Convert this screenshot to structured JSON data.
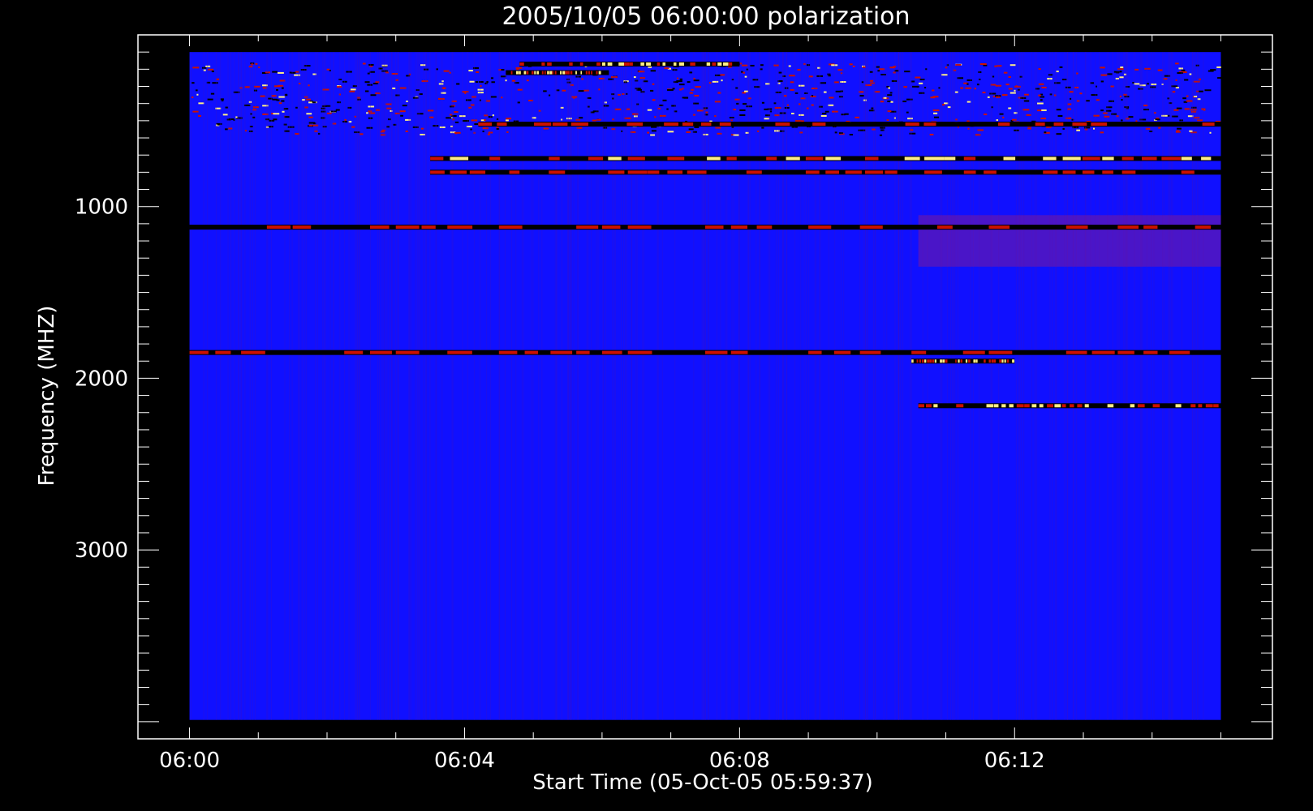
{
  "chart_data": {
    "type": "heatmap",
    "title": "2005/10/05 06:00:00 polarization",
    "xlabel": "Start Time (05-Oct-05 05:59:37)",
    "ylabel": "Frequency (MHZ)",
    "x_tick_labels": [
      "06:00",
      "06:04",
      "06:08",
      "06:12"
    ],
    "x_tick_minutes": [
      0,
      4,
      8,
      12
    ],
    "x_range_minutes": [
      -0.75,
      15.75
    ],
    "x_data_range_minutes": [
      0,
      15
    ],
    "y_tick_labels": [
      "1000",
      "2000",
      "3000"
    ],
    "y_tick_values": [
      1000,
      2000,
      3000
    ],
    "y_range_mhz": [
      0,
      4100
    ],
    "y_data_range_mhz": [
      100,
      3990
    ],
    "y_axis_inverted": true,
    "colormap": {
      "background": "#1010ff",
      "low": "#000000",
      "mid": "#cc1100",
      "high": "#ffee88"
    },
    "features": [
      {
        "freq_mhz": 170,
        "t_start": 4.8,
        "t_end": 8.0,
        "intensity": "high"
      },
      {
        "freq_mhz": 220,
        "t_start": 4.6,
        "t_end": 6.1,
        "intensity": "high"
      },
      {
        "freq_mhz": 520,
        "t_start": 4.2,
        "t_end": 15.0,
        "intensity": "mid"
      },
      {
        "freq_mhz": 720,
        "t_start": 3.5,
        "t_end": 15.0,
        "intensity": "high"
      },
      {
        "freq_mhz": 800,
        "t_start": 3.5,
        "t_end": 15.0,
        "intensity": "mid"
      },
      {
        "freq_mhz": 1120,
        "t_start": 0.0,
        "t_end": 15.0,
        "intensity": "mid"
      },
      {
        "freq_mhz": 1850,
        "t_start": 0.0,
        "t_end": 15.0,
        "intensity": "mid"
      },
      {
        "freq_mhz": 1900,
        "t_start": 10.5,
        "t_end": 12.0,
        "intensity": "high"
      },
      {
        "freq_mhz": 2160,
        "t_start": 10.6,
        "t_end": 15.0,
        "intensity": "high"
      }
    ]
  }
}
